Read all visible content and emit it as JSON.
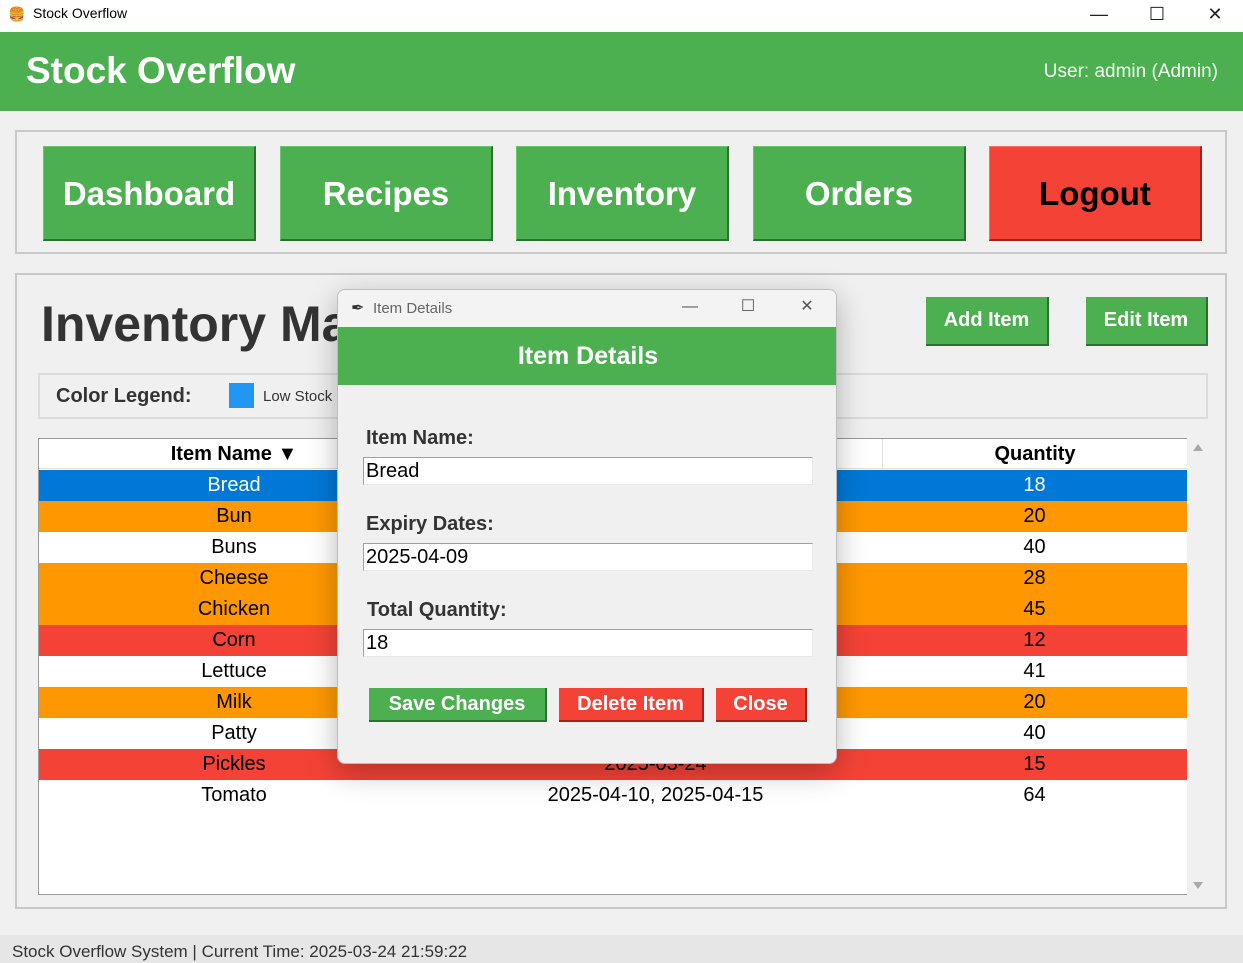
{
  "window": {
    "title": "Stock Overflow"
  },
  "header": {
    "brand": "Stock Overflow",
    "user": "User: admin (Admin)"
  },
  "nav": {
    "dashboard": "Dashboard",
    "recipes": "Recipes",
    "inventory": "Inventory",
    "orders": "Orders",
    "logout": "Logout"
  },
  "main": {
    "title": "Inventory Ma",
    "add_item": "Add Item",
    "edit_item": "Edit Item",
    "legend_label": "Color Legend:",
    "legend_low_stock": "Low Stock ("
  },
  "table": {
    "headers": {
      "name": "Item Name ▼",
      "expiry": "",
      "quantity": "Quantity"
    },
    "rows": [
      {
        "name": "Bread",
        "expiry": "",
        "quantity": "18"
      },
      {
        "name": "Bun",
        "expiry": "",
        "quantity": "20"
      },
      {
        "name": "Buns",
        "expiry": "",
        "quantity": "40"
      },
      {
        "name": "Cheese",
        "expiry": "",
        "quantity": "28"
      },
      {
        "name": "Chicken",
        "expiry": "",
        "quantity": "45"
      },
      {
        "name": "Corn",
        "expiry": "",
        "quantity": "12"
      },
      {
        "name": "Lettuce",
        "expiry": "",
        "quantity": "41"
      },
      {
        "name": "Milk",
        "expiry": "",
        "quantity": "20"
      },
      {
        "name": "Patty",
        "expiry": "",
        "quantity": "40"
      },
      {
        "name": "Pickles",
        "expiry": "2025-03-24",
        "quantity": "15"
      },
      {
        "name": "Tomato",
        "expiry": "2025-04-10, 2025-04-15",
        "quantity": "64"
      }
    ]
  },
  "colors": {
    "header_green": "#4caf50",
    "logout_red": "#f44336",
    "selected_blue": "#0078d7",
    "expiring_orange": "#ff9800",
    "low_stock_blue": "#2196f3"
  },
  "status": {
    "text": "Stock Overflow System | Current Time: 2025-03-24 21:59:22"
  },
  "dialog": {
    "window_title": "Item Details",
    "header": "Item Details",
    "item_name_label": "Item Name:",
    "item_name_value": "Bread",
    "expiry_label": "Expiry Dates:",
    "expiry_value": "2025-04-09",
    "quantity_label": "Total Quantity:",
    "quantity_value": "18",
    "save": "Save Changes",
    "delete": "Delete Item",
    "close": "Close"
  }
}
